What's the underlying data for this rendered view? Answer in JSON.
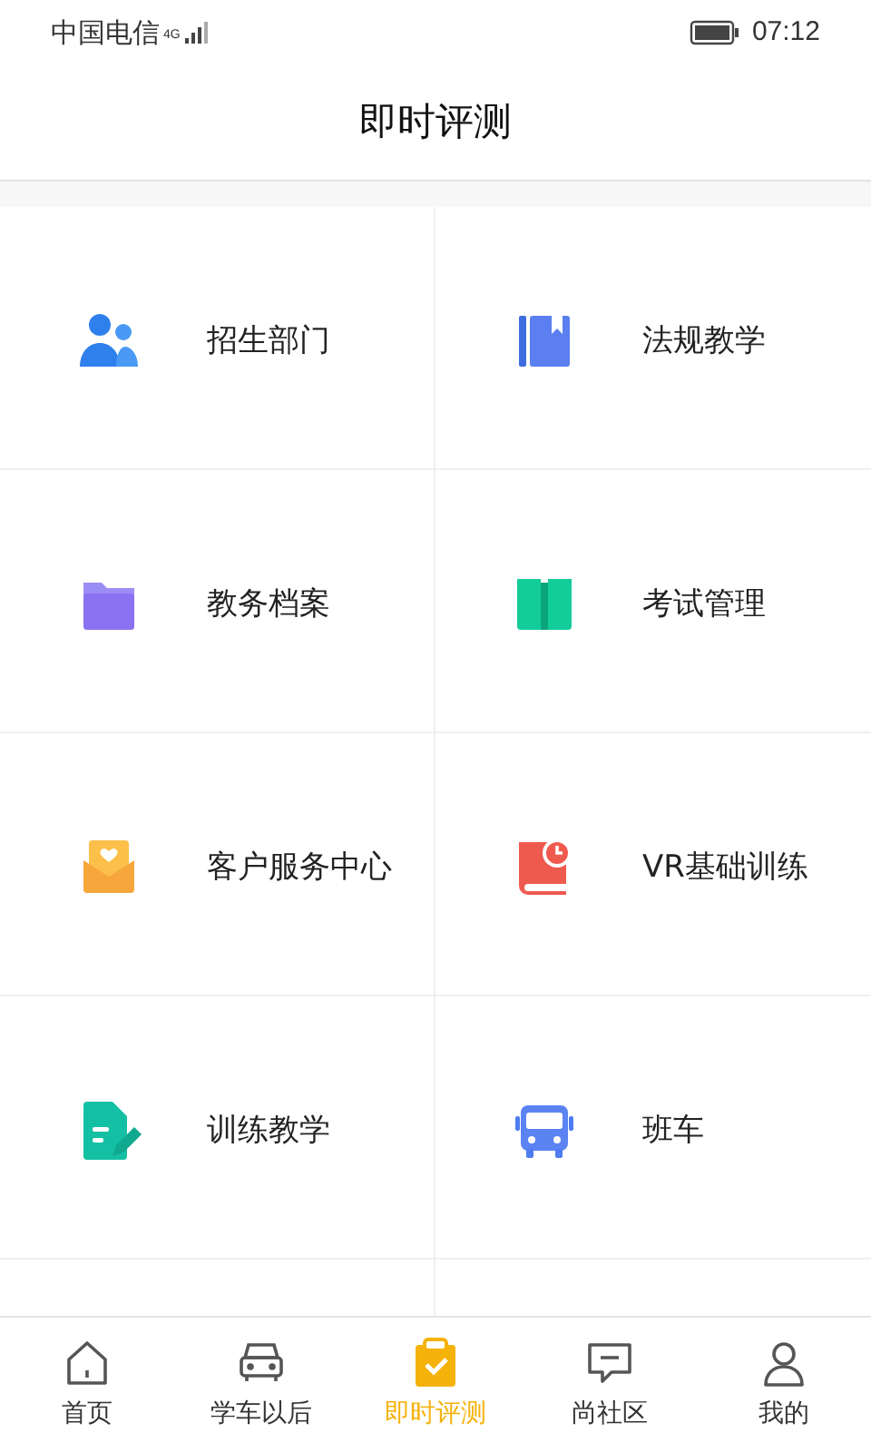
{
  "status_bar": {
    "carrier": "中国电信",
    "network": "4G",
    "time": "07:12"
  },
  "header": {
    "title": "即时评测"
  },
  "grid": [
    {
      "label": "招生部门"
    },
    {
      "label": "法规教学"
    },
    {
      "label": "教务档案"
    },
    {
      "label": "考试管理"
    },
    {
      "label": "客户服务中心"
    },
    {
      "label": "VR基础训练"
    },
    {
      "label": "训练教学"
    },
    {
      "label": "班车"
    }
  ],
  "tab_bar": [
    {
      "label": "首页",
      "selected": false
    },
    {
      "label": "学车以后",
      "selected": false
    },
    {
      "label": "即时评测",
      "selected": true
    },
    {
      "label": "尚社区",
      "selected": false
    },
    {
      "label": "我的",
      "selected": false
    }
  ]
}
